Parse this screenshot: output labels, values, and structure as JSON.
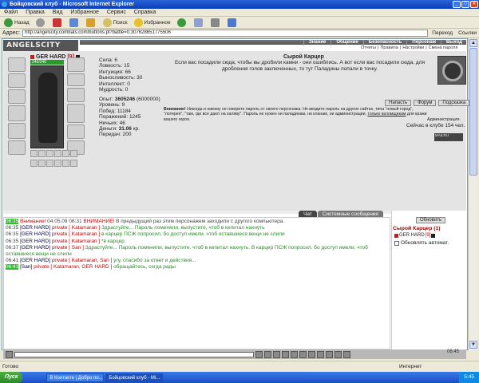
{
  "window": {
    "title": "Бойцовский клуб - Microsoft Internet Explorer"
  },
  "menu": [
    "Файл",
    "Правка",
    "Вид",
    "Избранное",
    "Сервис",
    "Справка"
  ],
  "toolbar": {
    "back": "Назад",
    "search": "Поиск",
    "favorites": "Избранное"
  },
  "address": {
    "label": "Адрес:",
    "url": "http://angelscity.combats.com/buttons.pl?battle=0.307628651775506",
    "go": "Переход",
    "links": "Ссылки"
  },
  "site": {
    "logo": "ANGELSCITY",
    "nav_main": [
      "Знание",
      "Общение",
      "Безопасность",
      "Персонаж",
      "Выход"
    ],
    "nav_sub": [
      "Отчеты",
      "Правила",
      "Настройки",
      "Смена пароля"
    ]
  },
  "character": {
    "name": "GER HARD",
    "level": "[9]",
    "hp": "246/246",
    "stats": [
      "Сила: 6",
      "Ловкость: 15",
      "Интуиция: 66",
      "Выносливость: 30",
      "Интеллект: 0",
      "Мудрость: 0"
    ],
    "exp_label": "Опыт:",
    "exp_value": "3605246",
    "exp_next": "(6000000)",
    "details": [
      "Уровень: 9",
      "Побед: 11184",
      "Поражений: 1245",
      "Ничьих: 46"
    ],
    "money_label": "Деньги:",
    "money_value": "31.06",
    "money_unit": "кр.",
    "transfers": "Передач: 200"
  },
  "location": {
    "title": "Сырой Карцер",
    "description": "Если вас посадили сюда, чтобы вы дробили камни - они ошиблись. А вот если вас посадили сюда, для дробления голов заключенных, то тут Паладины попали в точку."
  },
  "actions": [
    "Напасть",
    "Форум",
    "Подсказка"
  ],
  "warning": {
    "label": "Внимание!",
    "text": "Никогда и никому не говорите пароль от своего персонажа. Не вводите пароль на других сайтах, типа \"новый город\", \"лотерея\", \"там, где все дают на халяву\". Пароль не нужен ни паладинам, ни кланам, ни администрации,",
    "link": "только взломщикам",
    "tail": "для кражи вашего героя.",
    "admins": "Администрация."
  },
  "online": "Сейчас в клубе 154 чел.",
  "counter": "MAILRU",
  "chat": {
    "tabs": [
      "Чат",
      "Системные сообщения"
    ],
    "lines": [
      {
        "time": "06:35",
        "green": true,
        "parts": [
          {
            "c": "sys",
            "t": "Внимание!"
          },
          {
            "c": "txt-n",
            "t": " 04.05.09 06:31 "
          },
          {
            "c": "sys",
            "t": "ВНИМАНИЕ!"
          },
          {
            "c": "txt-n",
            "t": " В предыдущий раз этим персонажем заходили с другого компьютера."
          }
        ]
      },
      {
        "time": "06:35",
        "parts": [
          {
            "c": "nm",
            "t": "[GER HARD]"
          },
          {
            "c": "pv",
            "t": " private [ Katamaran ]"
          },
          {
            "c": "txt-g",
            "t": " Здрастуйте... Пароль поменяли, выпустите, чтоб в кепитал нахнуть"
          }
        ]
      },
      {
        "time": "06:35",
        "parts": [
          {
            "c": "nm",
            "t": "[GER HARD]"
          },
          {
            "c": "pv",
            "t": " private [ Katamaran ]"
          },
          {
            "c": "txt-g",
            "t": " в карцер ПСЖ попросил, бо доступ имели, чтоб оставшиеся вещи не слили"
          }
        ]
      },
      {
        "time": "06:35",
        "parts": [
          {
            "c": "nm",
            "t": "[GER HARD]"
          },
          {
            "c": "pv",
            "t": " private [ Katamaran ]"
          },
          {
            "c": "txt-g",
            "t": " *в карцер"
          }
        ]
      },
      {
        "time": "06:37",
        "parts": [
          {
            "c": "nm",
            "t": "[GER HARD]"
          },
          {
            "c": "pv",
            "t": " private [ San ]"
          },
          {
            "c": "txt-g",
            "t": " Здрастуйте... Пароль поменяли, выпустите, чтоб в кепитал нахнуть. В карцер ПСЖ попросил, бо доступ имели, чтоб оставшиеся вещи не слили"
          }
        ]
      },
      {
        "time": "06:41",
        "parts": [
          {
            "c": "nm",
            "t": "[GER HARD]"
          },
          {
            "c": "pv",
            "t": " private [ Katamaran, San ]"
          },
          {
            "c": "txt-g",
            "t": " угу, спасибо за ответ и действия..."
          }
        ]
      },
      {
        "time": "06:41",
        "green": true,
        "parts": [
          {
            "c": "nm",
            "t": "[San]"
          },
          {
            "c": "pv",
            "t": " private [ Katamaran, GER HARD ]"
          },
          {
            "c": "txt-g",
            "t": " обращайтесь, сегда рады"
          }
        ]
      }
    ]
  },
  "sidebar": {
    "refresh": "Обновить",
    "room": "Сырой Карцер (1)",
    "member_name": "GER HARD",
    "member_level": "[9]",
    "auto_refresh": "Обновлять автомат."
  },
  "bottom_clock": "06:45",
  "statusbar": {
    "text": "Готово",
    "zone": "Интернет"
  },
  "taskbar": {
    "start": "Пуск",
    "tasks": [
      "В Контакте | Добро по...",
      "Бойцовский клуб - Mi..."
    ],
    "clock": "5:45"
  }
}
